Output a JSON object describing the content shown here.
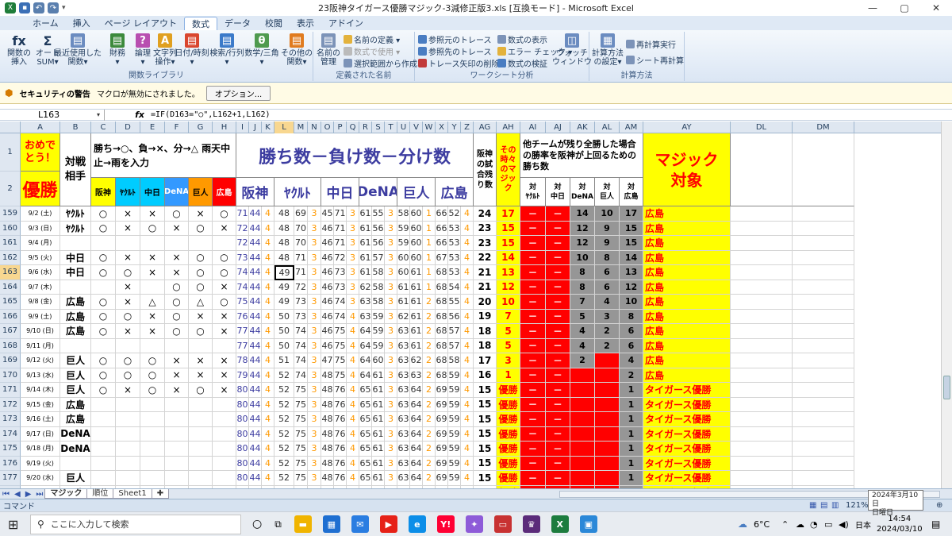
{
  "window": {
    "title": "23阪神タイガース優勝マジック-3減修正版3.xls [互換モード] - Microsoft Excel",
    "minimize": "—",
    "maximize": "▢",
    "close": "✕"
  },
  "tabs": [
    "ホーム",
    "挿入",
    "ページ レイアウト",
    "数式",
    "データ",
    "校閲",
    "表示",
    "アドイン"
  ],
  "ribbon": {
    "fn_lib": {
      "label": "関数ライブラリ",
      "buttons": [
        "関数の\n挿入",
        "オート\nSUM▾",
        "最近使用した\n関数▾",
        "財務\n▾",
        "論理\n▾",
        "文字列\n操作▾",
        "日付/時刻\n▾",
        "検索/行列\n▾",
        "数学/三角\n▾",
        "その他の\n関数▾"
      ]
    },
    "names": {
      "label": "定義された名前",
      "big": "名前の\n管理",
      "small": [
        "名前の定義 ▾",
        "数式で使用 ▾",
        "選択範囲から作成"
      ]
    },
    "audit": {
      "label": "ワークシート分析",
      "small": [
        "参照元のトレース",
        "参照先のトレース",
        "トレース矢印の削除 ▾",
        "数式の表示",
        "エラー チェック ▾",
        "数式の検証"
      ],
      "big": "ウォッチ\nウィンドウ"
    },
    "calc": {
      "label": "計算方法",
      "big": "計算方法\nの設定▾",
      "small": [
        "再計算実行",
        "シート再計算"
      ]
    }
  },
  "security": {
    "title": "セキュリティの警告",
    "message": "マクロが無効にされました。",
    "button": "オプション..."
  },
  "formula": {
    "name_box": "L163",
    "fx": "fx",
    "text": "=IF(D163=\"○\",L162+1,L162)"
  },
  "columns": [
    "A",
    "B",
    "C",
    "D",
    "E",
    "F",
    "G",
    "H",
    "I",
    "J",
    "K",
    "L",
    "M",
    "N",
    "O",
    "P",
    "Q",
    "R",
    "S",
    "T",
    "U",
    "V",
    "W",
    "X",
    "Y",
    "Z",
    "AG",
    "AH",
    "AI",
    "AJ",
    "AK",
    "AL",
    "AM",
    "AY",
    "DL",
    "DM"
  ],
  "header": {
    "omedeto": "おめでとう！",
    "yusho": "優勝",
    "taisen": "対戦\n相手",
    "rule": "勝ち→○、負→×、分→△ 雨天中止→雨を入力",
    "teams_short": [
      "阪神",
      "ﾔｸﾙﾄ",
      "中日",
      "DeNA",
      "巨人",
      "広島"
    ],
    "big": "勝ち数－負け数－分け数",
    "teams_big": [
      "阪神",
      "ﾔｸﾙﾄ",
      "中日",
      "DeNA",
      "巨人",
      "広島"
    ],
    "ag": "阪神の試合残り数",
    "ah": "その時々のマジック",
    "ai_title": "他チームが残り全勝した場合の勝率を阪神が上回るための勝ち数",
    "vs": [
      "対\nﾔｸﾙﾄ",
      "対\n中日",
      "対\nDeNA",
      "対\n巨人",
      "対\n広島"
    ],
    "magic_target": "マジック\n対象",
    "row1": "1",
    "row2": "2"
  },
  "rows": [
    {
      "n": "159",
      "a": "9/2 (土)",
      "b": "ﾔｸﾙﾄ",
      "r": [
        "○",
        "×",
        "×",
        "○",
        "×",
        "○"
      ],
      "s": [
        "71",
        "44",
        "4",
        "48",
        "69",
        "3",
        "45",
        "71",
        "3",
        "61",
        "55",
        "3",
        "58",
        "60",
        "1",
        "66",
        "52",
        "4"
      ],
      "ag": "24",
      "ah": "17",
      "ai": "－",
      "aj": "－",
      "ak": "14",
      "al": "10",
      "am": "17",
      "ay": "広島"
    },
    {
      "n": "160",
      "a": "9/3 (日)",
      "b": "ﾔｸﾙﾄ",
      "r": [
        "○",
        "×",
        "○",
        "×",
        "○",
        "×"
      ],
      "s": [
        "72",
        "44",
        "4",
        "48",
        "70",
        "3",
        "46",
        "71",
        "3",
        "61",
        "56",
        "3",
        "59",
        "60",
        "1",
        "66",
        "53",
        "4"
      ],
      "ag": "23",
      "ah": "15",
      "ai": "－",
      "aj": "－",
      "ak": "12",
      "al": "9",
      "am": "15",
      "ay": "広島"
    },
    {
      "n": "161",
      "a": "9/4 (月)",
      "b": "",
      "r": [
        "",
        "",
        "",
        "",
        "",
        ""
      ],
      "s": [
        "72",
        "44",
        "4",
        "48",
        "70",
        "3",
        "46",
        "71",
        "3",
        "61",
        "56",
        "3",
        "59",
        "60",
        "1",
        "66",
        "53",
        "4"
      ],
      "ag": "23",
      "ah": "15",
      "ai": "－",
      "aj": "－",
      "ak": "12",
      "al": "9",
      "am": "15",
      "ay": "広島"
    },
    {
      "n": "162",
      "a": "9/5 (火)",
      "b": "中日",
      "r": [
        "○",
        "×",
        "×",
        "×",
        "○",
        "○"
      ],
      "s": [
        "73",
        "44",
        "4",
        "48",
        "71",
        "3",
        "46",
        "72",
        "3",
        "61",
        "57",
        "3",
        "60",
        "60",
        "1",
        "67",
        "53",
        "4"
      ],
      "ag": "22",
      "ah": "14",
      "ai": "－",
      "aj": "－",
      "ak": "10",
      "al": "8",
      "am": "14",
      "ay": "広島"
    },
    {
      "n": "163",
      "a": "9/6 (水)",
      "b": "中日",
      "r": [
        "○",
        "○",
        "×",
        "×",
        "○",
        "○"
      ],
      "s": [
        "74",
        "44",
        "4",
        "49",
        "71",
        "3",
        "46",
        "73",
        "3",
        "61",
        "58",
        "3",
        "60",
        "61",
        "1",
        "68",
        "53",
        "4"
      ],
      "ag": "21",
      "ah": "13",
      "ai": "－",
      "aj": "－",
      "ak": "8",
      "al": "6",
      "am": "13",
      "ay": "広島"
    },
    {
      "n": "164",
      "a": "9/7 (木)",
      "b": "",
      "r": [
        "",
        "×",
        "",
        "○",
        "○",
        "×"
      ],
      "s": [
        "74",
        "44",
        "4",
        "49",
        "72",
        "3",
        "46",
        "73",
        "3",
        "62",
        "58",
        "3",
        "61",
        "61",
        "1",
        "68",
        "54",
        "4"
      ],
      "ag": "21",
      "ah": "12",
      "ai": "－",
      "aj": "－",
      "ak": "8",
      "al": "6",
      "am": "12",
      "ay": "広島"
    },
    {
      "n": "165",
      "a": "9/8 (金)",
      "b": "広島",
      "r": [
        "○",
        "×",
        "△",
        "○",
        "△",
        "○"
      ],
      "s": [
        "75",
        "44",
        "4",
        "49",
        "73",
        "3",
        "46",
        "74",
        "3",
        "63",
        "58",
        "3",
        "61",
        "61",
        "2",
        "68",
        "55",
        "4"
      ],
      "ag": "20",
      "ah": "10",
      "ai": "－",
      "aj": "－",
      "ak": "7",
      "al": "4",
      "am": "10",
      "ay": "広島"
    },
    {
      "n": "166",
      "a": "9/9 (土)",
      "b": "広島",
      "r": [
        "○",
        "○",
        "×",
        "○",
        "×",
        "×"
      ],
      "s": [
        "76",
        "44",
        "4",
        "50",
        "73",
        "3",
        "46",
        "74",
        "4",
        "63",
        "59",
        "3",
        "62",
        "61",
        "2",
        "68",
        "56",
        "4"
      ],
      "ag": "19",
      "ah": "7",
      "ai": "－",
      "aj": "－",
      "ak": "5",
      "al": "3",
      "am": "8",
      "ay": "広島"
    },
    {
      "n": "167",
      "a": "9/10 (日)",
      "b": "広島",
      "r": [
        "○",
        "×",
        "×",
        "○",
        "○",
        "×"
      ],
      "s": [
        "77",
        "44",
        "4",
        "50",
        "74",
        "3",
        "46",
        "75",
        "4",
        "64",
        "59",
        "3",
        "63",
        "61",
        "2",
        "68",
        "57",
        "4"
      ],
      "ag": "18",
      "ah": "5",
      "ai": "－",
      "aj": "－",
      "ak": "4",
      "al": "2",
      "am": "6",
      "ay": "広島"
    },
    {
      "n": "168",
      "a": "9/11 (月)",
      "b": "",
      "r": [
        "",
        "",
        "",
        "",
        "",
        ""
      ],
      "s": [
        "77",
        "44",
        "4",
        "50",
        "74",
        "3",
        "46",
        "75",
        "4",
        "64",
        "59",
        "3",
        "63",
        "61",
        "2",
        "68",
        "57",
        "4"
      ],
      "ag": "18",
      "ah": "5",
      "ai": "－",
      "aj": "－",
      "ak": "4",
      "al": "2",
      "am": "6",
      "ay": "広島"
    },
    {
      "n": "169",
      "a": "9/12 (火)",
      "b": "巨人",
      "r": [
        "○",
        "○",
        "○",
        "×",
        "×",
        "×"
      ],
      "s": [
        "78",
        "44",
        "4",
        "51",
        "74",
        "3",
        "47",
        "75",
        "4",
        "64",
        "60",
        "3",
        "63",
        "62",
        "2",
        "68",
        "58",
        "4"
      ],
      "ag": "17",
      "ah": "3",
      "ai": "－",
      "aj": "－",
      "ak": "2",
      "al": "－",
      "am": "4",
      "ay": "広島"
    },
    {
      "n": "170",
      "a": "9/13 (水)",
      "b": "巨人",
      "r": [
        "○",
        "○",
        "○",
        "×",
        "×",
        "×"
      ],
      "s": [
        "79",
        "44",
        "4",
        "52",
        "74",
        "3",
        "48",
        "75",
        "4",
        "64",
        "61",
        "3",
        "63",
        "63",
        "2",
        "68",
        "59",
        "4"
      ],
      "ag": "16",
      "ah": "1",
      "ai": "－",
      "aj": "－",
      "ak": "－",
      "al": "－",
      "am": "2",
      "ay": "広島"
    },
    {
      "n": "171",
      "a": "9/14 (木)",
      "b": "巨人",
      "r": [
        "○",
        "×",
        "○",
        "×",
        "○",
        "×"
      ],
      "s": [
        "80",
        "44",
        "4",
        "52",
        "75",
        "3",
        "48",
        "76",
        "4",
        "65",
        "61",
        "3",
        "63",
        "64",
        "2",
        "69",
        "59",
        "4"
      ],
      "ag": "15",
      "ah": "優勝",
      "ai": "－",
      "aj": "－",
      "ak": "－",
      "al": "－",
      "am": "1",
      "ay": "タイガース優勝"
    },
    {
      "n": "172",
      "a": "9/15 (金)",
      "b": "広島",
      "r": [
        "",
        "",
        "",
        "",
        "",
        ""
      ],
      "s": [
        "80",
        "44",
        "4",
        "52",
        "75",
        "3",
        "48",
        "76",
        "4",
        "65",
        "61",
        "3",
        "63",
        "64",
        "2",
        "69",
        "59",
        "4"
      ],
      "ag": "15",
      "ah": "優勝",
      "ai": "－",
      "aj": "－",
      "ak": "－",
      "al": "－",
      "am": "1",
      "ay": "タイガース優勝"
    },
    {
      "n": "173",
      "a": "9/16 (土)",
      "b": "広島",
      "r": [
        "",
        "",
        "",
        "",
        "",
        ""
      ],
      "s": [
        "80",
        "44",
        "4",
        "52",
        "75",
        "3",
        "48",
        "76",
        "4",
        "65",
        "61",
        "3",
        "63",
        "64",
        "2",
        "69",
        "59",
        "4"
      ],
      "ag": "15",
      "ah": "優勝",
      "ai": "－",
      "aj": "－",
      "ak": "－",
      "al": "－",
      "am": "1",
      "ay": "タイガース優勝"
    },
    {
      "n": "174",
      "a": "9/17 (日)",
      "b": "DeNA",
      "r": [
        "",
        "",
        "",
        "",
        "",
        ""
      ],
      "s": [
        "80",
        "44",
        "4",
        "52",
        "75",
        "3",
        "48",
        "76",
        "4",
        "65",
        "61",
        "3",
        "63",
        "64",
        "2",
        "69",
        "59",
        "4"
      ],
      "ag": "15",
      "ah": "優勝",
      "ai": "－",
      "aj": "－",
      "ak": "－",
      "al": "－",
      "am": "1",
      "ay": "タイガース優勝"
    },
    {
      "n": "175",
      "a": "9/18 (月)",
      "b": "DeNA",
      "r": [
        "",
        "",
        "",
        "",
        "",
        ""
      ],
      "s": [
        "80",
        "44",
        "4",
        "52",
        "75",
        "3",
        "48",
        "76",
        "4",
        "65",
        "61",
        "3",
        "63",
        "64",
        "2",
        "69",
        "59",
        "4"
      ],
      "ag": "15",
      "ah": "優勝",
      "ai": "－",
      "aj": "－",
      "ak": "－",
      "al": "－",
      "am": "1",
      "ay": "タイガース優勝"
    },
    {
      "n": "176",
      "a": "9/19 (火)",
      "b": "",
      "r": [
        "",
        "",
        "",
        "",
        "",
        ""
      ],
      "s": [
        "80",
        "44",
        "4",
        "52",
        "75",
        "3",
        "48",
        "76",
        "4",
        "65",
        "61",
        "3",
        "63",
        "64",
        "2",
        "69",
        "59",
        "4"
      ],
      "ag": "15",
      "ah": "優勝",
      "ai": "－",
      "aj": "－",
      "ak": "－",
      "al": "－",
      "am": "1",
      "ay": "タイガース優勝"
    },
    {
      "n": "177",
      "a": "9/20 (水)",
      "b": "巨人",
      "r": [
        "",
        "",
        "",
        "",
        "",
        ""
      ],
      "s": [
        "80",
        "44",
        "4",
        "52",
        "75",
        "3",
        "48",
        "76",
        "4",
        "65",
        "61",
        "3",
        "63",
        "64",
        "2",
        "69",
        "59",
        "4"
      ],
      "ag": "15",
      "ah": "優勝",
      "ai": "－",
      "aj": "－",
      "ak": "－",
      "al": "－",
      "am": "1",
      "ay": "タイガース優勝"
    },
    {
      "n": "178",
      "a": "9/21 (木)",
      "b": "巨人",
      "r": [
        "",
        "",
        "",
        "",
        "",
        ""
      ],
      "s": [
        "80",
        "44",
        "4",
        "52",
        "75",
        "3",
        "48",
        "76",
        "4",
        "65",
        "61",
        "3",
        "63",
        "64",
        "2",
        "69",
        "59",
        "4"
      ],
      "ag": "15",
      "ah": "優勝",
      "ai": "－",
      "aj": "－",
      "ak": "－",
      "al": "－",
      "am": "1",
      "ay": "タイガース優勝"
    }
  ],
  "sheets": [
    "マジック",
    "順位",
    "Sheet1"
  ],
  "status": {
    "mode": "コマンド",
    "zoom": "121%"
  },
  "tooltip": {
    "date": "2024年3月10日",
    "weekday": "日曜日"
  },
  "taskbar": {
    "search_placeholder": "ここに入力して検索",
    "weather": "6°C",
    "ime": "日本",
    "time": "14:54",
    "date": "2024/03/10"
  },
  "colors": {
    "yellow": "#ffff00",
    "red": "#ff0000",
    "gray": "#969696",
    "blue": "#3c3ca0",
    "orange": "#ff9900",
    "ribbon": "#dfe9f5"
  }
}
